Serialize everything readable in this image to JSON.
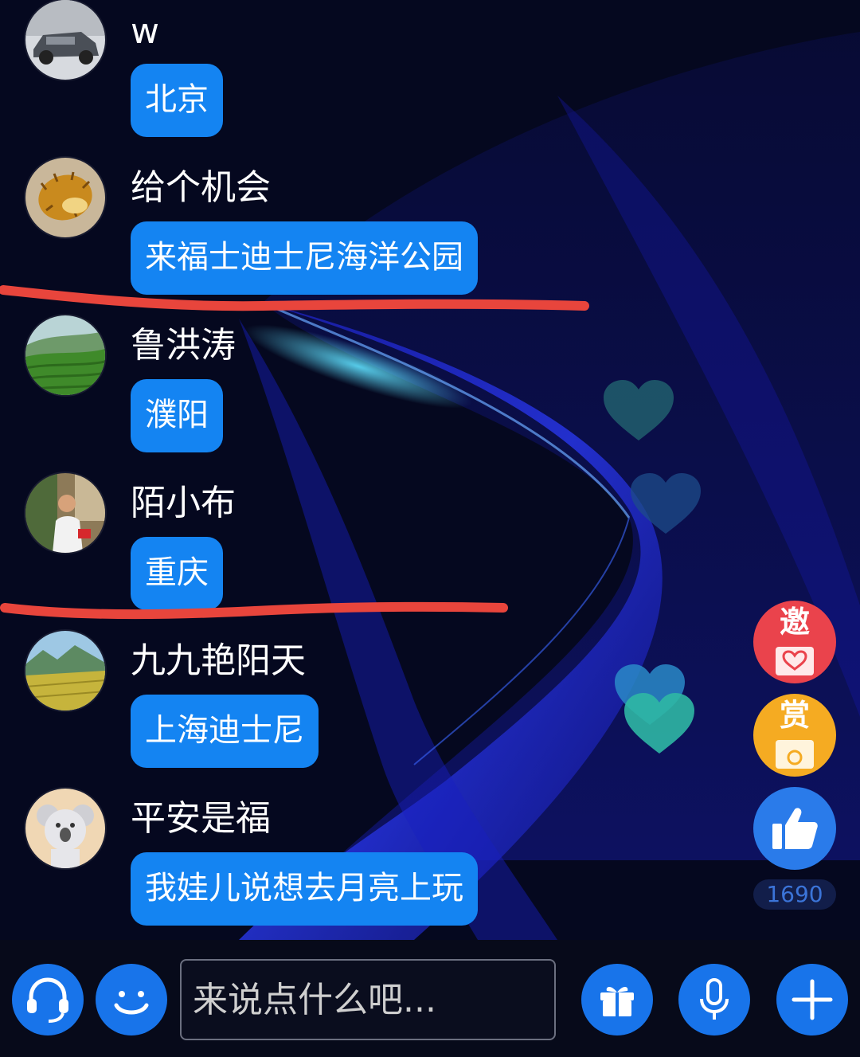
{
  "messages": [
    {
      "user": "w",
      "text": "北京",
      "avatar": "car-avatar"
    },
    {
      "user": "给个机会",
      "text": "来福士迪士尼海洋公园",
      "avatar": "durian-avatar"
    },
    {
      "user": "鲁洪涛",
      "text": "濮阳",
      "avatar": "tea-field-avatar"
    },
    {
      "user": "陌小布",
      "text": "重庆",
      "avatar": "person-avatar"
    },
    {
      "user": "九九艳阳天",
      "text": "上海迪士尼",
      "avatar": "landscape-avatar"
    },
    {
      "user": "平安是福",
      "text": "我娃儿说想去月亮上玩",
      "avatar": "koala-avatar"
    }
  ],
  "side_actions": {
    "invite_label": "邀",
    "reward_label": "赏",
    "like_icon": "thumbs-up-icon",
    "like_count": "1690"
  },
  "bottom_bar": {
    "input_placeholder": "来说点什么吧...",
    "icons": [
      "headset-icon",
      "emoji-icon",
      "gift-icon",
      "microphone-icon",
      "plus-icon"
    ]
  },
  "colors": {
    "bubble": "#1484f2",
    "background": "#05081f",
    "annotation_line": "#e8453c",
    "invite_button": "#e8414a",
    "reward_button": "#f4a821",
    "like_button": "#2a7bea"
  }
}
